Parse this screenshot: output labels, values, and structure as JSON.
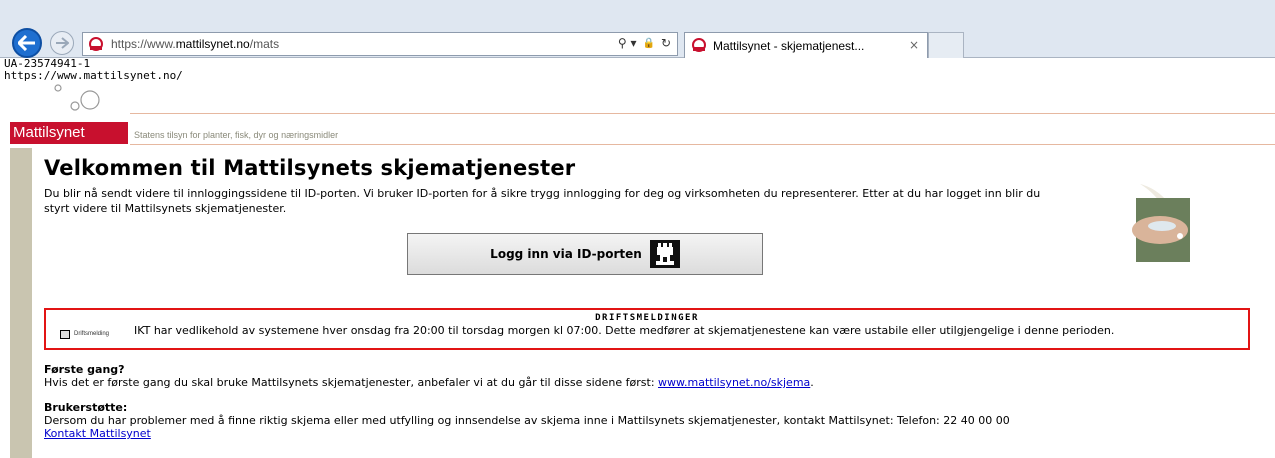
{
  "browser": {
    "url_prefix": "https://www.",
    "url_domain": "mattilsynet.no",
    "url_path": "/mats",
    "tab_title": "Mattilsynet - skjematjenest...",
    "tab_close": "×",
    "search_symbol": "⚲ ▾",
    "lock_symbol": "🔒",
    "refresh_symbol": "↻"
  },
  "debug": {
    "line1": "UA-23574941-1",
    "line2": "https://www.mattilsynet.no/"
  },
  "header": {
    "logo_text": "Mattilsynet",
    "tagline": "Statens tilsyn for planter, fisk, dyr og næringsmidler"
  },
  "main": {
    "title": "Velkommen til Mattilsynets skjematjenester",
    "intro": "Du blir nå sendt videre til innloggingssidene til ID-porten. Vi bruker ID-porten for å sikre trygg innlogging for deg og virksomheten du representerer. Etter at du har logget inn blir du styrt videre til Mattilsynets skjematjenester.",
    "login_button": "Logg inn via ID-porten"
  },
  "driftsmeldinger": {
    "title": "DRIFTSMELDINGER",
    "label": "Driftsmelding",
    "text": "IKT har vedlikehold av systemene hver onsdag fra 20:00 til torsdag morgen kl 07:00. Dette medfører at skjematjenestene kan være ustabile eller utilgjengelige i denne perioden."
  },
  "forste_gang": {
    "heading": "Første gang?",
    "text": "Hvis det er første gang du skal bruke Mattilsynets skjematjenester, anbefaler vi at du går til disse sidene først: ",
    "link": "www.mattilsynet.no/skjema",
    "suffix": "."
  },
  "brukerstotte": {
    "heading": "Brukerstøtte:",
    "text": "Dersom du har problemer med å finne riktig skjema eller med utfylling og innsendelse av skjema inne i Mattilsynets skjematjenester, kontakt Mattilsynet: Telefon: 22 40 00 00",
    "link": "Kontakt Mattilsynet"
  },
  "colors": {
    "brand_red": "#c8102e",
    "alert_border": "#e21414",
    "link": "#0000cc"
  }
}
